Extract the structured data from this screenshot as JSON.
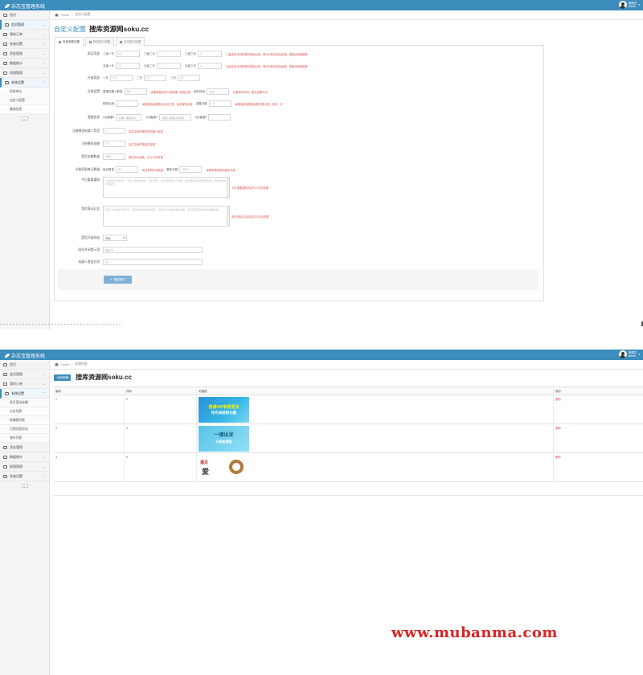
{
  "app": {
    "title": "杂志宝管理系统",
    "user_name": "管理员",
    "user_role": "admin"
  },
  "colors": {
    "brand": "#3c8dbc",
    "hint_red": "#d9534f",
    "watermark": "#dd2222"
  },
  "screen1": {
    "breadcrumb": {
      "home": "Home",
      "current": "自定义配置"
    },
    "sidebar": [
      {
        "label": "首页",
        "icon": "home-icon",
        "has_children": false
      },
      {
        "label": "会员管理",
        "icon": "user-icon",
        "has_children": true,
        "active": true
      },
      {
        "label": "我的订单",
        "icon": "order-icon",
        "has_children": true
      },
      {
        "label": "系统设置",
        "icon": "shuffle-icon",
        "has_children": true
      },
      {
        "label": "资金管理",
        "icon": "money-icon",
        "has_children": true
      },
      {
        "label": "数据统计",
        "icon": "chart-icon",
        "has_children": true
      },
      {
        "label": "权限管理",
        "icon": "file-icon",
        "has_children": true
      },
      {
        "label": "系统设置",
        "icon": "gear-icon",
        "has_children": true
      }
    ],
    "sidebar_sub": [
      "系统单位",
      "自定义配置",
      "基础信息"
    ],
    "page_title": "自定义配置",
    "site_name": "搜库资源网soku.cc",
    "tabs": [
      "系统参数设置",
      "短信接口设置",
      "支付接口设置"
    ],
    "form": {
      "row1": {
        "label": "购买奖励",
        "fields": [
          {
            "sub": "三级一代",
            "value": "10"
          },
          {
            "sub": "三级二代",
            "value": "7"
          },
          {
            "sub": "三级三代",
            "value": "4"
          }
        ],
        "hint": "三级会员分别获得的奖励比例；单位%购买商品返佣，直推或间接推荐"
      },
      "row2": {
        "fields": [
          {
            "sub": "五级一代",
            "value": "10"
          },
          {
            "sub": "五级二代",
            "value": "7"
          },
          {
            "sub": "五级三代",
            "value": "4"
          }
        ],
        "hint": "五级会员分别获得的奖励比例；单位%购买商品返佣，直推或间接推荐"
      },
      "row3": {
        "label": "升级奖励",
        "fields": [
          {
            "sub": "一代",
            "value": "0.5"
          },
          {
            "sub": "二代",
            "value": "0.3"
          },
          {
            "sub": "三代",
            "value": "0.1"
          }
        ]
      },
      "row4": {
        "label": "分销设置",
        "field1_sub": "直推机器人数量",
        "field1_value": "100",
        "hint1": "设置直推会员分销机器人奖励比例",
        "field2_sub": "返利时间",
        "field2_value": "30天",
        "hint2": "设置返利时间，建议设置30天"
      },
      "row5": {
        "field1_sub": "释放比例",
        "field1_value": "1",
        "hint1": "每笔释放金额按此比例分发，最多释放天数",
        "field2_sub": "设置天数",
        "field2_value": "1.2",
        "hint2": "每笔释放金额按设置天数分配，单位：天"
      },
      "row6": {
        "label": "客服信息",
        "fields": [
          {
            "sub": "QQ客服1",
            "value": "请输入客服QQ"
          },
          {
            "sub": "QQ客服2",
            "value": "请输入客服QQ号码"
          },
          {
            "sub": "QQ客服3",
            "value": ""
          }
        ]
      },
      "row7": {
        "label": "注册赠送机器人类型",
        "value": "1",
        "hint": "会员注册时赠送的机器人类型"
      },
      "row8": {
        "label": "注册赠送金额",
        "value": "10",
        "hint": "会员注册时赠送的金额"
      },
      "row9": {
        "label": "首页金额数量",
        "value": "3950",
        "hint": "首页显示金额，可以手动设置"
      },
      "row10": {
        "label": "分量奖励每日数量",
        "sub1": "每日数量",
        "value1": "50",
        "hint1": "每日获得分量奖励",
        "sub2": "最多天数",
        "value2": "1000",
        "hint2": "设置获得奖励的最多天数"
      },
      "row11": {
        "label": "今日重要通知",
        "text": "公告内容示例文字，平台公告通知信息，用户须知，请仔细阅读以下内容，如有疑问请联系客服处理，感谢您的支持与配合。",
        "hint": "今日重要通知内容可以手动设置"
      },
      "row12": {
        "label": "首页滚动公告",
        "text": "滚动公告内容示例文字，平台最新动态信息展示，请用户关注最新活动内容，如有疑问请联系在线客服处理。",
        "hint": "首页滚动公告内容可以手动设置"
      },
      "row13": {
        "label": "是否开启网站",
        "value": "开启"
      },
      "row14": {
        "label": "网站关闭提示语",
        "value": "维护中……"
      },
      "row15": {
        "label": "机器人收益比例",
        "value": "10"
      },
      "save_label": "确定提交"
    }
  },
  "screen2": {
    "breadcrumb": {
      "home": "Home",
      "current": "轮播列表"
    },
    "sidebar": [
      {
        "label": "首页",
        "icon": "home-icon",
        "has_children": false
      },
      {
        "label": "会员管理",
        "icon": "user-icon",
        "has_children": true
      },
      {
        "label": "我的订单",
        "icon": "order-icon",
        "has_children": true
      },
      {
        "label": "系统设置",
        "icon": "shuffle-icon",
        "has_children": true,
        "active": true
      }
    ],
    "sidebar_sub": [
      "首页滚动轮播",
      "公告列表",
      "轮播图列表",
      "日期内容添加",
      "城市列表"
    ],
    "sidebar_after": [
      {
        "label": "资金管理",
        "icon": "money-icon"
      },
      {
        "label": "数据统计",
        "icon": "chart-icon"
      },
      {
        "label": "权限管理",
        "icon": "file-icon"
      },
      {
        "label": "系统设置",
        "icon": "gear-icon"
      }
    ],
    "add_button": "+添加轮播",
    "title": "搜库资源网soku.cc",
    "columns": [
      "编号",
      "排序",
      "轮播图",
      "操作"
    ],
    "rows": [
      {
        "id": "1",
        "sort": "0",
        "banner_text": [
          "普通VIP享受更多",
          "抢先体验新功能"
        ],
        "action": "删除"
      },
      {
        "id": "2",
        "sort": "0",
        "banner_text": [
          "一键出发",
          "开启新旅程"
        ],
        "action": "删除"
      },
      {
        "id": "3",
        "sort": "0",
        "banner_text": [
          "遇见",
          "爱"
        ],
        "action": "删除"
      }
    ]
  },
  "watermark": "www.mubanma.com"
}
